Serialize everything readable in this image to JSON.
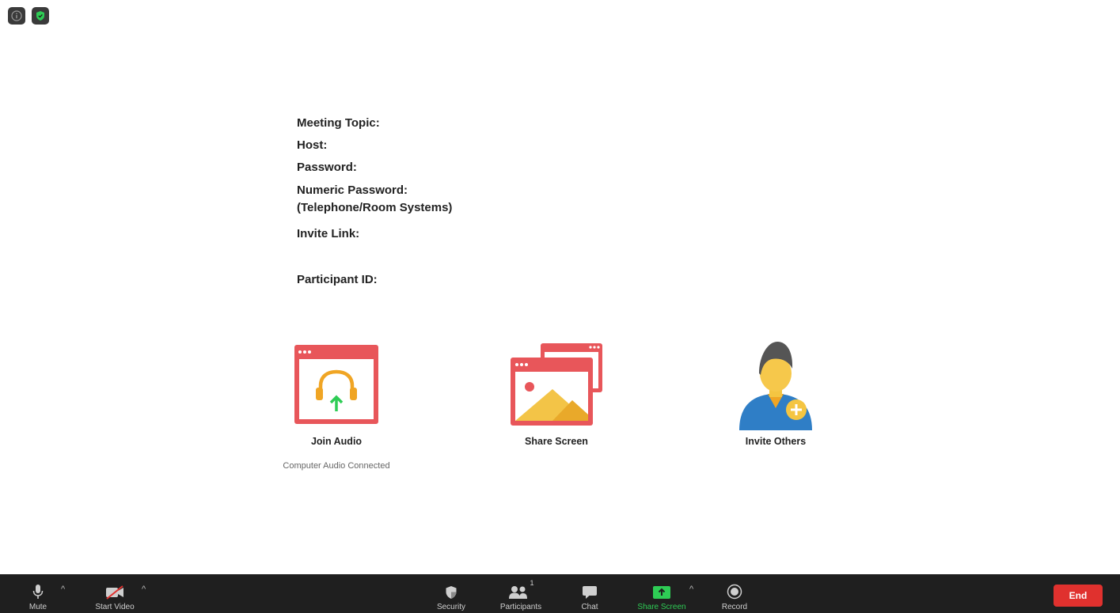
{
  "top_icons": [
    {
      "name": "info-icon"
    },
    {
      "name": "shield-icon",
      "color": "#2ecc55"
    }
  ],
  "meeting_info": {
    "topic_label": "Meeting Topic:",
    "host_label": "Host:",
    "password_label": "Password:",
    "numeric_password_label": "Numeric Password:",
    "numeric_password_sub": "(Telephone/Room Systems)",
    "invite_link_label": "Invite Link:",
    "participant_id_label": "Participant ID:"
  },
  "actions": {
    "join_audio": {
      "label": "Join Audio",
      "status": "Computer Audio Connected"
    },
    "share_screen": {
      "label": "Share Screen"
    },
    "invite_others": {
      "label": "Invite Others"
    }
  },
  "toolbar": {
    "mute": "Mute",
    "start_video": "Start Video",
    "security": "Security",
    "participants": "Participants",
    "participants_count": "1",
    "chat": "Chat",
    "share_screen": "Share Screen",
    "record": "Record",
    "end": "End"
  },
  "colors": {
    "toolbar_bg": "#1f1f1f",
    "accent_green": "#2ecc55",
    "end_red": "#e0312e",
    "card_red": "#e8565a"
  }
}
